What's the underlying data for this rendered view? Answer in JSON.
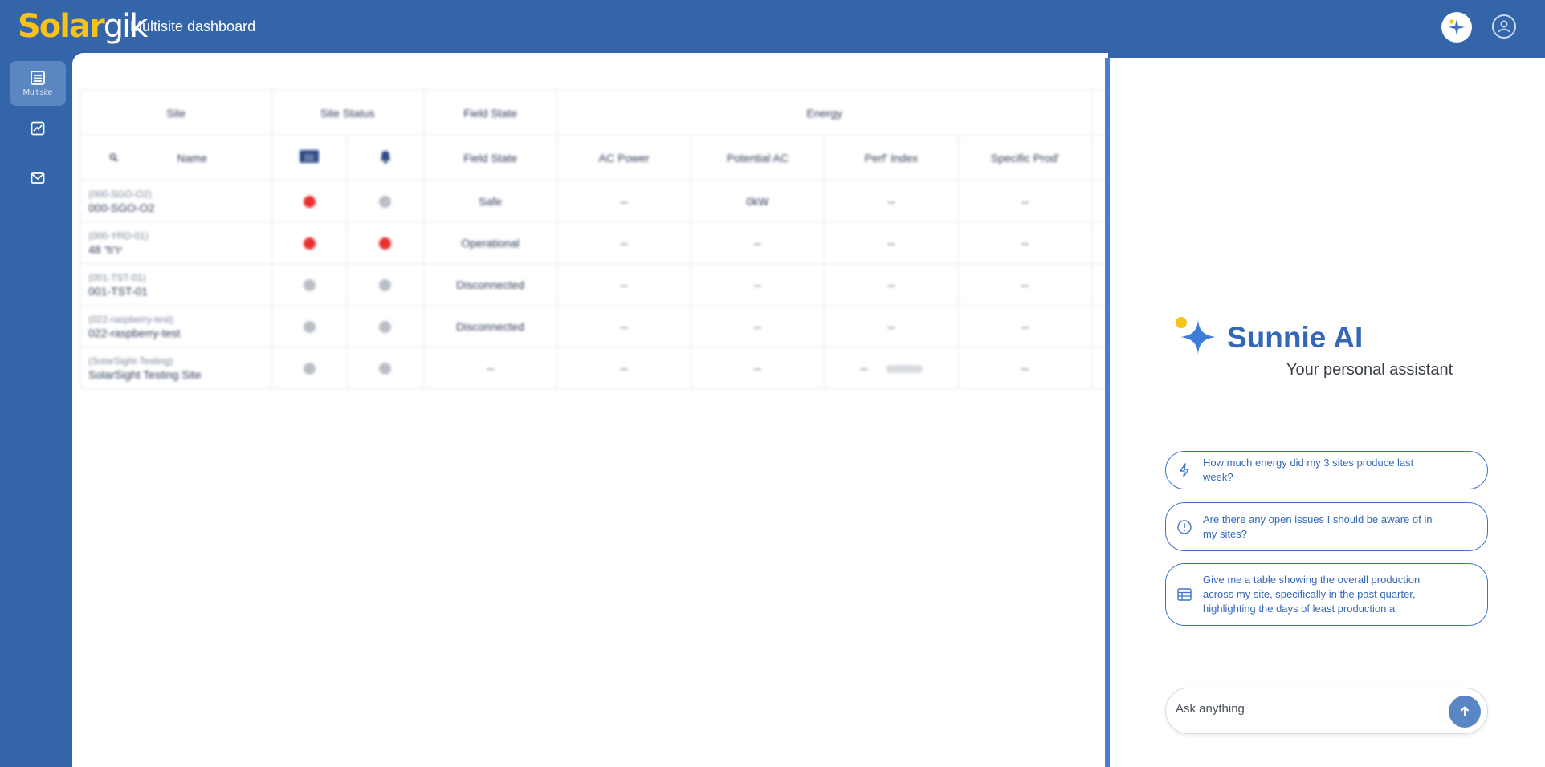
{
  "header": {
    "logo_part1": "Solar",
    "logo_part2": "gik",
    "title": "Multisite dashboard",
    "ai_icon": "sparkle-icon",
    "user_icon": "user-icon"
  },
  "sidebar": {
    "items": [
      {
        "label": "Multisite",
        "icon": "list-icon"
      },
      {
        "label": "",
        "icon": "reports-icon"
      },
      {
        "label": "",
        "icon": "mail-icon"
      }
    ]
  },
  "table": {
    "group_headers": {
      "site": "Site",
      "site_status": "Site Status",
      "field_state": "Field State",
      "energy": "Energy"
    },
    "columns": {
      "name": "Name",
      "field_state": "Field State",
      "ac_power": "AC Power",
      "potential_ac": "Potential AC",
      "perf_index": "Perf' Index",
      "specific_prod": "Specific Prod'"
    },
    "rows": [
      {
        "code": "(000-SGO-O2)",
        "name": "000-SGO-O2",
        "status1": "red",
        "status2": "grey",
        "field_state": "Safe",
        "ac_power": "--",
        "potential_ac": "0kW",
        "perf_index": "--",
        "specific_prod": "--"
      },
      {
        "code": "(000-YRD-01)",
        "name": "ירוד 48",
        "status1": "red",
        "status2": "red",
        "field_state": "Operational",
        "ac_power": "--",
        "potential_ac": "--",
        "perf_index": "--",
        "specific_prod": "--"
      },
      {
        "code": "(001-TST-01)",
        "name": "001-TST-01",
        "status1": "grey",
        "status2": "grey",
        "field_state": "Disconnected",
        "ac_power": "--",
        "potential_ac": "--",
        "perf_index": "--",
        "specific_prod": "--"
      },
      {
        "code": "(022-raspberry-test)",
        "name": "022-raspberry-test",
        "status1": "grey",
        "status2": "grey",
        "field_state": "Disconnected",
        "ac_power": "--",
        "potential_ac": "--",
        "perf_index": "--",
        "specific_prod": "--"
      },
      {
        "code": "(SolarSight-Testing)",
        "name": "SolarSight Testing Site",
        "status1": "grey",
        "status2": "grey",
        "field_state": "--",
        "ac_power": "--",
        "potential_ac": "--",
        "perf_index": "--",
        "specific_prod": "--"
      }
    ]
  },
  "assistant": {
    "title": "Sunnie AI",
    "subtitle": "Your personal assistant",
    "suggestions": [
      {
        "icon": "bolt-icon",
        "text": "How much energy did my 3 sites produce last week?"
      },
      {
        "icon": "alert-icon",
        "text": "Are there any open issues I should be aware of in my sites?"
      },
      {
        "icon": "table-icon",
        "text": "Give me a table showing the overall production across my site, specifically in the past quarter, highlighting the days of least production a"
      }
    ],
    "input_placeholder": "Ask anything",
    "send_icon": "arrow-up-icon"
  },
  "colors": {
    "brand_blue": "#3465a8",
    "accent_blue": "#3567b8",
    "logo_yellow": "#f7c21b",
    "status_red": "#ea2f2f",
    "status_grey": "#b9bec7"
  }
}
